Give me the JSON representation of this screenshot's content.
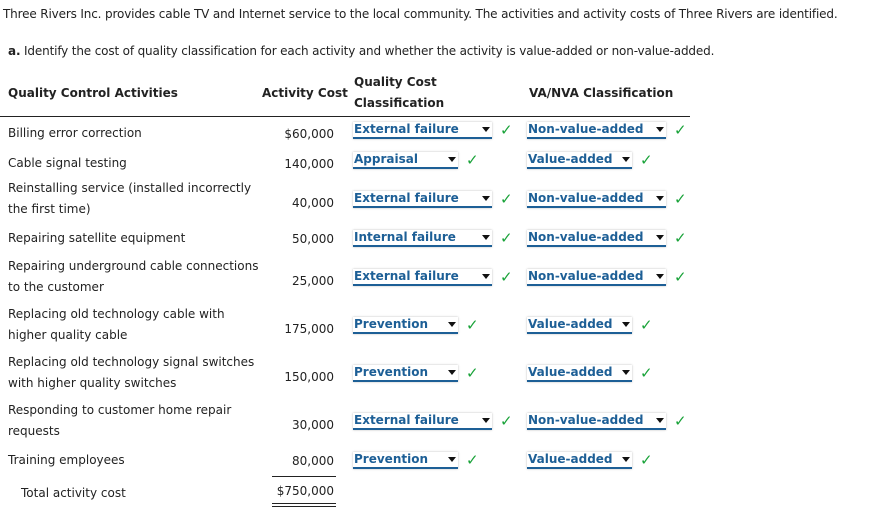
{
  "intro": "Three Rivers Inc. provides cable TV and Internet service to the local community. The activities and activity costs of Three Rivers are identified.",
  "question": {
    "label": "a.",
    "text": "Identify the cost of quality classification for each activity and whether the activity is value-added or non-value-added."
  },
  "headers": {
    "activities": "Quality Control Activities",
    "cost": "Activity Cost",
    "qcc_line1": "Quality Cost",
    "qcc_line2": "Classification",
    "va": "VA/NVA Classification"
  },
  "rows": [
    {
      "activity": "Billing error correction",
      "cost": "$60,000",
      "qcc": "External failure",
      "va": "Non-value-added",
      "qcc_correct": true,
      "va_correct": true
    },
    {
      "activity": "Cable signal testing",
      "cost": "140,000",
      "qcc": "Appraisal",
      "va": "Value-added",
      "qcc_correct": true,
      "va_correct": true
    },
    {
      "activity": "Reinstalling service (installed incorrectly the first time)",
      "cost": "40,000",
      "qcc": "External failure",
      "va": "Non-value-added",
      "qcc_correct": true,
      "va_correct": true
    },
    {
      "activity": "Repairing satellite equipment",
      "cost": "50,000",
      "qcc": "Internal failure",
      "va": "Non-value-added",
      "qcc_correct": true,
      "va_correct": true
    },
    {
      "activity": "Repairing underground cable connections to the customer",
      "cost": "25,000",
      "qcc": "External failure",
      "va": "Non-value-added",
      "qcc_correct": true,
      "va_correct": true
    },
    {
      "activity": "Replacing old technology cable with higher quality cable",
      "cost": "175,000",
      "qcc": "Prevention",
      "va": "Value-added",
      "qcc_correct": true,
      "va_correct": true
    },
    {
      "activity": "Replacing old technology signal switches with higher quality switches",
      "cost": "150,000",
      "qcc": "Prevention",
      "va": "Value-added",
      "qcc_correct": true,
      "va_correct": true
    },
    {
      "activity": "Responding to customer home repair requests",
      "cost": "30,000",
      "qcc": "External failure",
      "va": "Non-value-added",
      "qcc_correct": true,
      "va_correct": true
    },
    {
      "activity": "Training employees",
      "cost": "80,000",
      "qcc": "Prevention",
      "va": "Value-added",
      "qcc_correct": true,
      "va_correct": true
    }
  ],
  "total": {
    "label": "Total activity cost",
    "value": "$750,000"
  },
  "check_glyph": "✓",
  "colors": {
    "select_text": "#1d5f96",
    "check": "#1aa33a"
  }
}
